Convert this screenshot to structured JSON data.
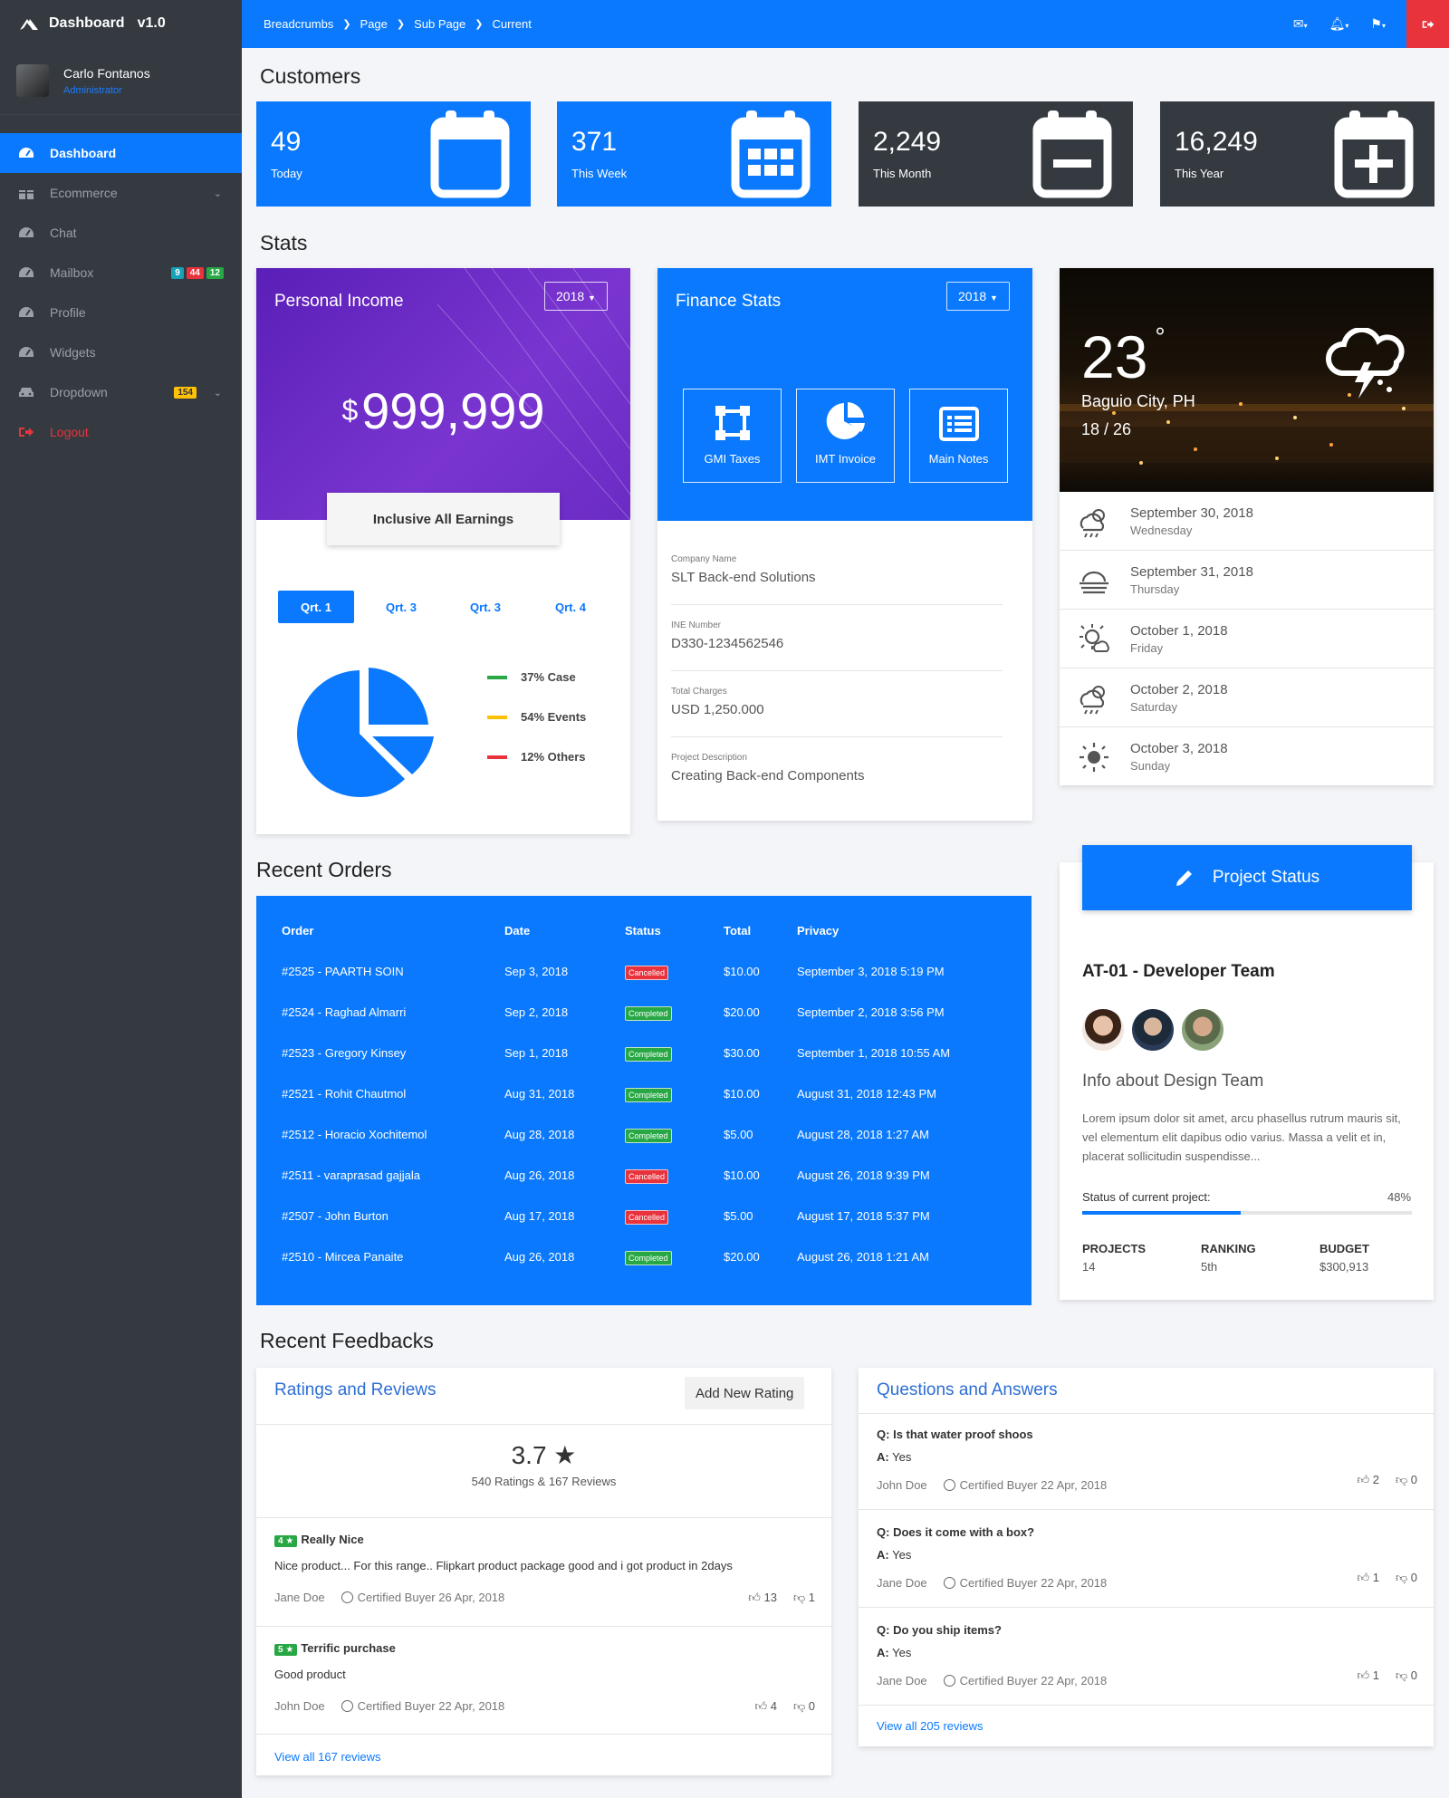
{
  "sidebar": {
    "brand": "Dashboard",
    "version": "v1.0",
    "user_name": "Carlo Fontanos",
    "user_role": "Administrator",
    "items": [
      {
        "label": "Dashboard"
      },
      {
        "label": "Ecommerce"
      },
      {
        "label": "Chat"
      },
      {
        "label": "Mailbox",
        "badges": [
          "9",
          "44",
          "12"
        ]
      },
      {
        "label": "Profile"
      },
      {
        "label": "Widgets"
      },
      {
        "label": "Dropdown",
        "badges": [
          "154"
        ]
      },
      {
        "label": "Logout"
      }
    ]
  },
  "topbar": {
    "breadcrumbs": [
      "Breadcrumbs",
      "Page",
      "Sub Page",
      "Current"
    ]
  },
  "customers": {
    "title": "Customers",
    "cards": [
      {
        "value": "49",
        "label": "Today"
      },
      {
        "value": "371",
        "label": "This Week"
      },
      {
        "value": "2,249",
        "label": "This Month"
      },
      {
        "value": "16,249",
        "label": "This Year"
      }
    ]
  },
  "stats": {
    "title": "Stats",
    "income": {
      "title": "Personal Income",
      "year": "2018",
      "currency": "$",
      "amount": "999,999",
      "badge": "Inclusive All Earnings",
      "quarters": [
        "Qrt. 1",
        "Qrt. 3",
        "Qrt. 3",
        "Qrt. 4"
      ],
      "legend": [
        "37% Case",
        "54% Events",
        "12% Others"
      ]
    },
    "finance": {
      "title": "Finance Stats",
      "year": "2018",
      "buttons": [
        "GMI Taxes",
        "IMT Invoice",
        "Main Notes"
      ],
      "rows": [
        {
          "key": "Company Name",
          "value": "SLT Back-end Solutions"
        },
        {
          "key": "INE Number",
          "value": "D330-1234562546"
        },
        {
          "key": "Total Charges",
          "value": "USD 1,250.000"
        },
        {
          "key": "Project Description",
          "value": "Creating Back-end Components"
        }
      ]
    },
    "weather": {
      "temp": "23",
      "degree": "°",
      "city": "Baguio City, PH",
      "range": "18 / 26",
      "forecast": [
        {
          "date": "September 30, 2018",
          "day": "Wednesday"
        },
        {
          "date": "September 31, 2018",
          "day": "Thursday"
        },
        {
          "date": "October 1, 2018",
          "day": "Friday"
        },
        {
          "date": "October 2, 2018",
          "day": "Saturday"
        },
        {
          "date": "October 3, 2018",
          "day": "Sunday"
        }
      ]
    }
  },
  "orders": {
    "title": "Recent Orders",
    "headers": [
      "Order",
      "Date",
      "Status",
      "Total",
      "Privacy"
    ],
    "rows": [
      {
        "order": "#2525 - PAARTH SOIN",
        "date": "Sep 3, 2018",
        "status": "Cancelled",
        "total": "$10.00",
        "privacy": "September 3, 2018 5:19 PM"
      },
      {
        "order": "#2524 - Raghad Almarri",
        "date": "Sep 2, 2018",
        "status": "Completed",
        "total": "$20.00",
        "privacy": "September 2, 2018 3:56 PM"
      },
      {
        "order": "#2523 - Gregory Kinsey",
        "date": "Sep 1, 2018",
        "status": "Completed",
        "total": "$30.00",
        "privacy": "September 1, 2018 10:55 AM"
      },
      {
        "order": "#2521 - Rohit Chautmol",
        "date": "Aug 31, 2018",
        "status": "Completed",
        "total": "$10.00",
        "privacy": "August 31, 2018 12:43 PM"
      },
      {
        "order": "#2512 - Horacio Xochitemol",
        "date": "Aug 28, 2018",
        "status": "Completed",
        "total": "$5.00",
        "privacy": "August 28, 2018 1:27 AM"
      },
      {
        "order": "#2511 - varaprasad gajjala",
        "date": "Aug 26, 2018",
        "status": "Cancelled",
        "total": "$10.00",
        "privacy": "August 26, 2018 9:39 PM"
      },
      {
        "order": "#2507 - John Burton",
        "date": "Aug 17, 2018",
        "status": "Cancelled",
        "total": "$5.00",
        "privacy": "August 17, 2018 5:37 PM"
      },
      {
        "order": "#2510 - Mircea Panaite",
        "date": "Aug 26, 2018",
        "status": "Completed",
        "total": "$20.00",
        "privacy": "August 26, 2018 1:21 AM"
      }
    ]
  },
  "project": {
    "header": "Project Status",
    "team": "AT-01 - Developer Team",
    "info_title": "Info about Design Team",
    "description": "Lorem ipsum dolor sit amet, arcu phasellus rutrum mauris sit, vel elementum elit dapibus odio varius. Massa a velit et in, placerat sollicitudin suspendisse...",
    "status_label": "Status of current project:",
    "status_pct": "48%",
    "progress": 0.48,
    "metrics": [
      {
        "key": "PROJECTS",
        "value": "14"
      },
      {
        "key": "RANKING",
        "value": "5th"
      },
      {
        "key": "BUDGET",
        "value": "$300,913"
      }
    ]
  },
  "feedbacks": {
    "title": "Recent Feedbacks",
    "ratings": {
      "title": "Ratings and Reviews",
      "add_button": "Add New Rating",
      "score": "3.7 ★",
      "summary": "540 Ratings & 167 Reviews",
      "reviews": [
        {
          "stars": "4 ★",
          "title": "Really Nice",
          "text": "Nice product... For this range.. Flipkart product package good and i got product in 2days",
          "author": "Jane Doe",
          "cert": "Certified Buyer 26 Apr, 2018",
          "up": "13",
          "down": "1"
        },
        {
          "stars": "5 ★",
          "title": "Terrific purchase",
          "text": "Good product",
          "author": "John Doe",
          "cert": "Certified Buyer 22 Apr, 2018",
          "up": "4",
          "down": "0"
        }
      ],
      "view_all": "View all 167 reviews"
    },
    "qa": {
      "title": "Questions and Answers",
      "items": [
        {
          "q": "Is that water proof shoos",
          "a": "Yes",
          "author": "John Doe",
          "cert": "Certified Buyer 22 Apr, 2018",
          "up": "2",
          "down": "0"
        },
        {
          "q": "Does it come with a box?",
          "a": "Yes",
          "author": "Jane Doe",
          "cert": "Certified Buyer 22 Apr, 2018",
          "up": "1",
          "down": "0"
        },
        {
          "q": "Do you ship items?",
          "a": "Yes",
          "author": "Jane Doe",
          "cert": "Certified Buyer 22 Apr, 2018",
          "up": "1",
          "down": "0"
        }
      ],
      "q_prefix": "Q:",
      "a_prefix": "A:",
      "view_all": "View all 205 reviews"
    }
  },
  "colors": {
    "primary": "#0a79fd",
    "dark": "#343a40",
    "danger": "#e8333d",
    "success": "#28a745",
    "warning": "#ffc107",
    "purple": "#6a2bc4"
  }
}
